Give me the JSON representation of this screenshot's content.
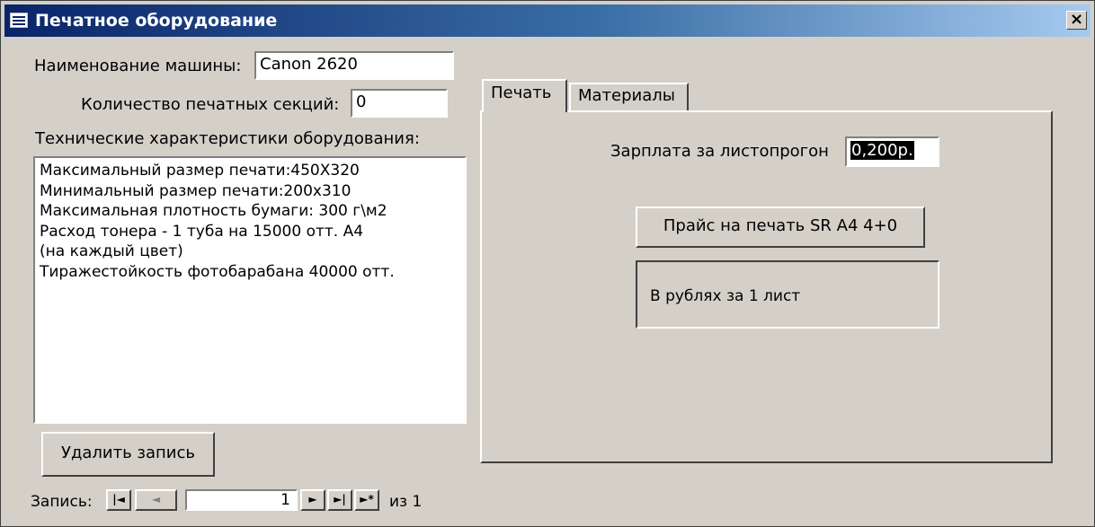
{
  "window": {
    "title": "Печатное оборудование",
    "close_label": "×"
  },
  "form": {
    "machine_name_label": "Наименование машины:",
    "machine_name_value": "Canon 2620",
    "sections_label": "Количество печатных секций:",
    "sections_value": "0",
    "specs_label": "Технические характеристики оборудования:",
    "specs_lines": [
      "Максимальный размер печати:450X320",
      "Минимальный размер печати:200x310",
      "Максимальная плотность бумаги: 300 г\\м2",
      "Расход тонера - 1 туба на 15000 отт. А4",
      "(на каждый цвет)",
      "Тиражестойкость фотобарабана 40000 отт."
    ],
    "delete_button_label": "Удалить запись"
  },
  "tabs": [
    {
      "label": "Печать",
      "active": true
    },
    {
      "label": "Материалы",
      "active": false
    }
  ],
  "print_tab": {
    "salary_label": "Зарплата за листопрогон",
    "salary_value": "0,200р.",
    "price_button_label": "Прайс на печать SR A4 4+0",
    "price_note": "В рублях за 1 лист"
  },
  "record_nav": {
    "label": "Запись:",
    "first_icon": "first-record-icon",
    "prev_icon": "prev-record-icon",
    "next_icon": "next-record-icon",
    "last_icon": "last-record-icon",
    "new_icon": "new-record-icon",
    "current": "1",
    "of_label": "из",
    "total": "1"
  }
}
